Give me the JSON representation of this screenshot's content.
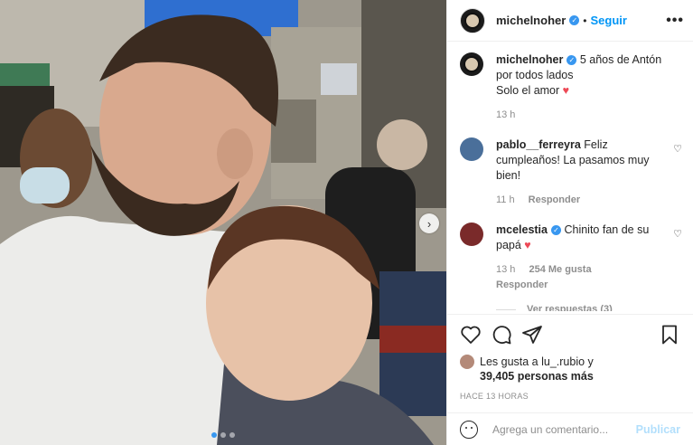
{
  "post": {
    "username": "michelnoher",
    "follow_label": "Seguir",
    "more_label": "•••"
  },
  "caption": {
    "username": "michelnoher",
    "text_line1": "5 años de Antón por todos lados",
    "text_line2": "Solo el amor",
    "time": "13 h"
  },
  "comments": [
    {
      "username": "pablo__ferreyra",
      "text": "Feliz cumpleaños! La pasamos muy bien!",
      "time": "11 h",
      "reply_label": "Responder"
    },
    {
      "username": "mcelestia",
      "text": "Chinito fan de su papá",
      "time": "13 h",
      "likes": "254 Me gusta",
      "reply_label": "Responder",
      "view_replies": "Ver respuestas (3)"
    }
  ],
  "likes": {
    "line1": "Les gusta a lu_.rubio y",
    "line2": "39,405 personas más"
  },
  "time_ago": "HACE 13 HORAS",
  "comment_input": {
    "placeholder": "Agrega un comentario...",
    "publish_label": "Publicar"
  },
  "colors": {
    "accent": "#0095f6",
    "like_red": "#ed4956",
    "muted": "#8e8e8e"
  }
}
